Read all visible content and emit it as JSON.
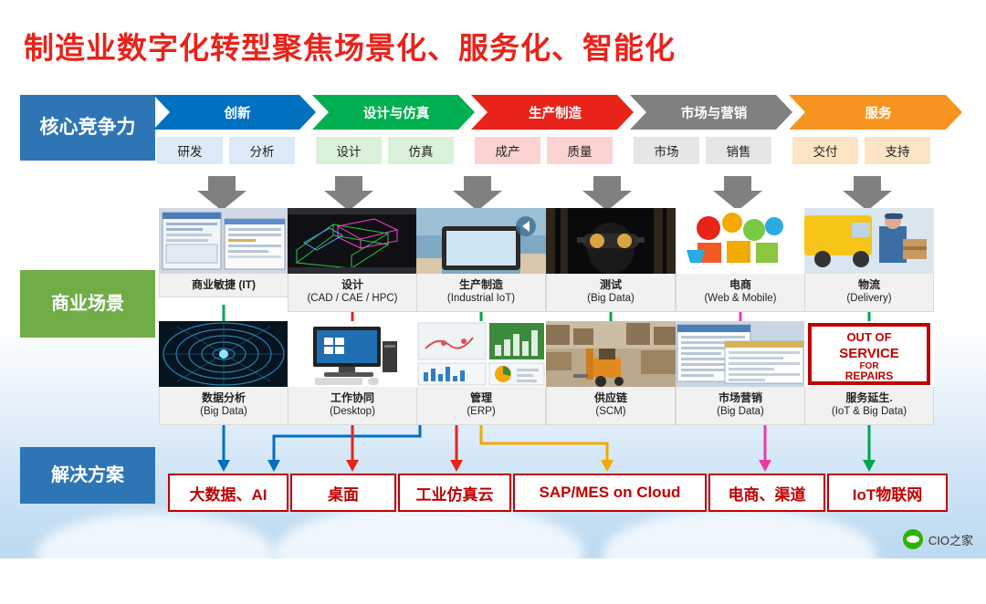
{
  "title": "制造业数字化转型聚焦场景化、服务化、智能化",
  "rows": {
    "core_label": "核心竞争力",
    "business_label": "商业场景",
    "solution_label": "解决方案"
  },
  "pillars": [
    {
      "label": "创新",
      "color": "#0070c0",
      "subs": [
        "研发",
        "分析"
      ],
      "sub_color": "#dce9f7"
    },
    {
      "label": "设计与仿真",
      "color": "#00b050",
      "subs": [
        "设计",
        "仿真"
      ],
      "sub_color": "#d9f2d9"
    },
    {
      "label": "生产制造",
      "color": "#e8231a",
      "subs": [
        "成产",
        "质量"
      ],
      "sub_color": "#fbd4d2"
    },
    {
      "label": "市场与营销",
      "color": "#808080",
      "subs": [
        "市场",
        "销售"
      ],
      "sub_color": "#e6e6e6"
    },
    {
      "label": "服务",
      "color": "#f79420",
      "subs": [
        "交付",
        "支持"
      ],
      "sub_color": "#fde4c4"
    }
  ],
  "scenes_top": [
    {
      "title": "商业敏捷 (IT)",
      "sub": "",
      "thumb": "dashboard-screens"
    },
    {
      "title": "设计",
      "sub": "(CAD / CAE / HPC)",
      "thumb": "cad-wireframe"
    },
    {
      "title": "生产制造",
      "sub": "(Industrial IoT)",
      "thumb": "tablet-factory"
    },
    {
      "title": "测试",
      "sub": "(Big Data)",
      "thumb": "engineer-goggles"
    },
    {
      "title": "电商",
      "sub": "(Web & Mobile)",
      "thumb": "ecommerce-icons"
    },
    {
      "title": "物流",
      "sub": "(Delivery)",
      "thumb": "delivery-van"
    }
  ],
  "scenes_bottom": [
    {
      "title": "数据分析",
      "sub": "(Big Data)",
      "thumb": "data-tunnel"
    },
    {
      "title": "工作协同",
      "sub": "(Desktop)",
      "thumb": "desktop-pc"
    },
    {
      "title": "管理",
      "sub": "(ERP)",
      "thumb": "analytics-dashboard"
    },
    {
      "title": "供应链",
      "sub": "(SCM)",
      "thumb": "warehouse-forklift"
    },
    {
      "title": "市场营销",
      "sub": "(Big Data)",
      "thumb": "crm-screens"
    },
    {
      "title": "服务延生.",
      "sub": "(IoT & Big Data)",
      "thumb": "out-of-service-sign"
    }
  ],
  "service_sign": {
    "line1": "OUT OF",
    "line2": "SERVICE",
    "line3": "FOR",
    "line4": "REPAIRS"
  },
  "solutions": [
    {
      "label": "大数据、AI",
      "connector_color": "#0070c0"
    },
    {
      "label": "桌面",
      "connector_color": "#e8231a"
    },
    {
      "label": "工业仿真云",
      "connector_color": "#e8231a"
    },
    {
      "label": "SAP/MES on Cloud",
      "connector_color": "#f2a900"
    },
    {
      "label": "电商、渠道",
      "connector_color": "#ef38a5"
    },
    {
      "label": "IoT物联网",
      "connector_color": "#00a550"
    }
  ],
  "watermark": "CIO之家",
  "colors": {
    "title": "#e8231a",
    "core_label_bg": "#2e75b6",
    "business_label_bg": "#70ad47",
    "solution_label_bg": "#2e75b6",
    "solution_border": "#c00000"
  }
}
